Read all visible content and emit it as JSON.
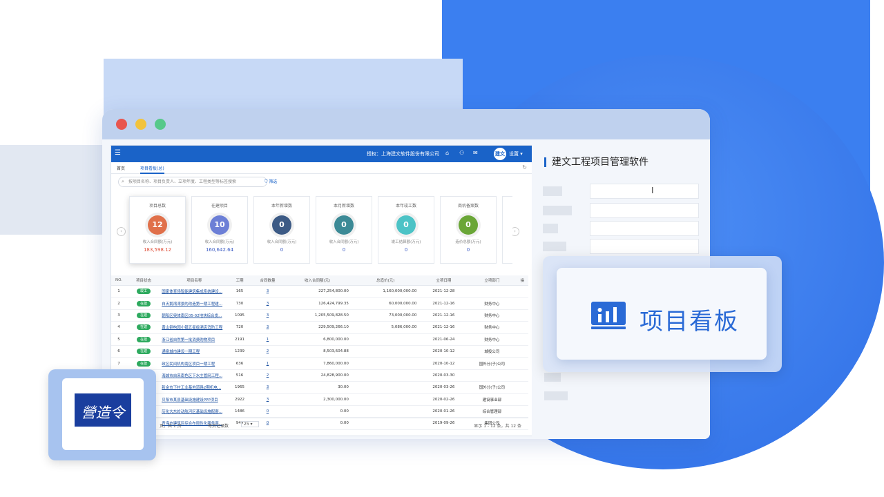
{
  "app": {
    "company": "授权：上海建文软件股份有限公司",
    "avatar_text": "建文",
    "settings": "设置 ▾",
    "tabs": [
      "首页",
      "项目看板(总)"
    ],
    "search_placeholder": "按项目名称、项目负责人、立项年度、工程类型等标签搜索",
    "filter_label": "筛选"
  },
  "cards": [
    {
      "title": "项目总数",
      "count": "12",
      "sub": "收入合同额(万元)",
      "value": "183,598.12",
      "color": "#e0704a",
      "value_color": "#e0503a"
    },
    {
      "title": "在建项目",
      "count": "10",
      "sub": "收入合同额(万元)",
      "value": "160,642.64",
      "color": "#6c7fd6",
      "value_color": "#3b5bc4"
    },
    {
      "title": "本年新增数",
      "count": "0",
      "sub": "收入合同额(万元)",
      "value": "0",
      "color": "#3c5a85",
      "value_color": "#3b5bc4"
    },
    {
      "title": "本月新增数",
      "count": "0",
      "sub": "收入合同额(万元)",
      "value": "0",
      "color": "#3c8a96",
      "value_color": "#3b5bc4"
    },
    {
      "title": "本年竣工数",
      "count": "0",
      "sub": "竣工结算额(万元)",
      "value": "0",
      "color": "#4cc3c6",
      "value_color": "#3b5bc4"
    },
    {
      "title": "商机备案数",
      "count": "0",
      "sub": "造价总额(万元)",
      "value": "0",
      "color": "#6aa637",
      "value_color": "#3b5bc4"
    }
  ],
  "table": {
    "headers": [
      "NO.",
      "项目状态",
      "项目名称",
      "工期",
      "合同数量",
      "收入合同额(元)",
      "总造价(元)",
      "立项日期",
      "立项部门",
      "操"
    ],
    "rows": [
      [
        "1",
        "竣工",
        "国家体育场智能建筑集成系统建设...",
        "165",
        "3",
        "227,254,800.00",
        "1,160,000,000.00",
        "2021-12-28",
        ""
      ],
      [
        "2",
        "在建",
        "白天鹅湾湾景的改造第一期工程建...",
        "730",
        "3",
        "126,424,799.35",
        "60,000,000.00",
        "2021-12-16",
        "财务中心"
      ],
      [
        "3",
        "在建",
        "朝阳区奥体南区05-02地块综合发...",
        "1095",
        "3",
        "1,205,509,828.50",
        "73,000,000.00",
        "2021-12-16",
        "财务中心"
      ],
      [
        "4",
        "在建",
        "黄山钢构园小镇五星级酒店消防工程",
        "720",
        "3",
        "229,509,266.10",
        "5,086,000.00",
        "2021-12-16",
        "财务中心"
      ],
      [
        "5",
        "在建",
        "浙江省自然第一批消费购物项目",
        "2191",
        "1",
        "6,800,000.00",
        "",
        "2021-06-24",
        "财务中心"
      ],
      [
        "6",
        "在建",
        "通泉城市建设一期工程",
        "1239",
        "2",
        "8,503,604.88",
        "",
        "2020-10-12",
        "城投公司"
      ],
      [
        "7",
        "在建",
        "政区民间机构南区项目一期工程",
        "636",
        "1",
        "7,860,000.00",
        "",
        "2020-10-12",
        "国外分(子)公司"
      ],
      [
        "8",
        "在建",
        "海城市自来南色区下水主管网工程...",
        "516",
        "2",
        "24,828,900.00",
        "",
        "2020-03-30",
        ""
      ],
      [
        "9",
        "在建",
        "新余市下村工业基地道路2期机电...",
        "1965",
        "3",
        "30.00",
        "",
        "2020-03-26",
        "国外分(子)公司"
      ],
      [
        "10",
        "在建",
        "贝阳市某县基础设施建设PPP项目",
        "2922",
        "3",
        "2,300,000.00",
        "",
        "2020-02-26",
        "建设事业部"
      ],
      [
        "11",
        "在建",
        "历化大东岭动航河区基础设施配套...",
        "1486",
        "0",
        "0.00",
        "",
        "2020-01-26",
        "综合管理部"
      ],
      [
        "12",
        "在建",
        "青海市建筑区综合布局性化服务商...",
        "944",
        "0",
        "0.00",
        "",
        "2019-09-26",
        "集团公司"
      ]
    ]
  },
  "pager": {
    "left": "页，共 1 页",
    "size_label": "每页记录数",
    "size_value": "25",
    "right": "显示 1 - 12 条，共 12 条"
  },
  "form": {
    "title": "建文工程项目管理软件"
  },
  "board": {
    "label": "项目看板"
  },
  "logo": {
    "text": "營造令"
  },
  "colors": {
    "accent": "#1a63c8",
    "board_text": "#2a6ad6",
    "status_green": "#2eaa5f"
  }
}
